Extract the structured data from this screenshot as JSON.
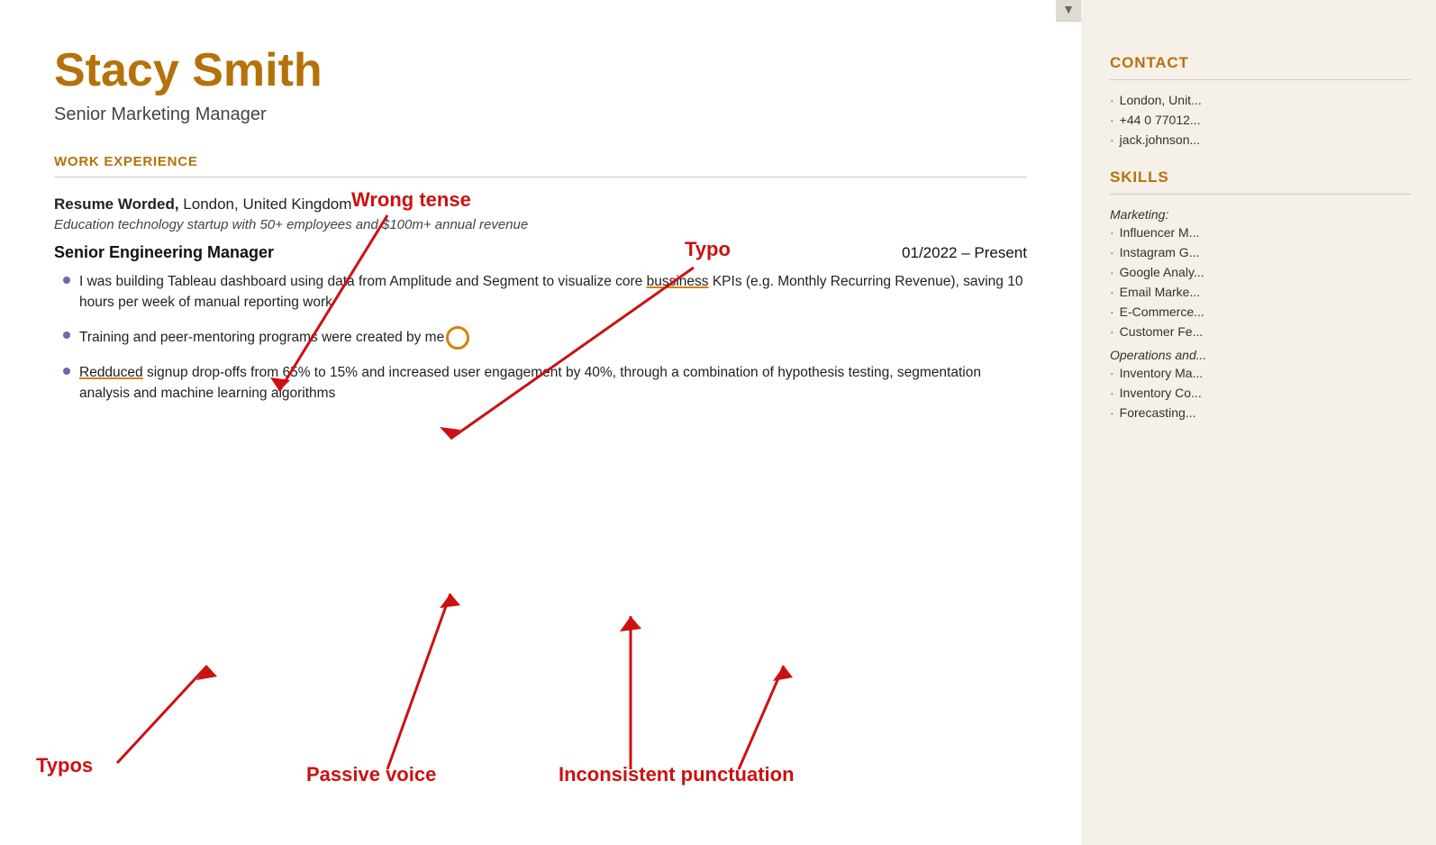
{
  "candidate": {
    "name": "Stacy Smith",
    "title": "Senior Marketing Manager"
  },
  "sections": {
    "work_experience_label": "WORK EXPERIENCE",
    "contact_label": "CONTACT",
    "skills_label": "SKILLS"
  },
  "work_experience": {
    "company": "Resume Worded,",
    "company_rest": " London, United Kingdom",
    "company_desc": "Education technology startup with 50+ employees and $100m+ annual revenue",
    "job_title": "Senior Engineering Manager",
    "dates": "01/2022 – Present",
    "bullets": [
      {
        "text_parts": [
          {
            "text": "I was building Tableau da"
          },
          {
            "text": "shboard using data from Amplitude and Segment to visualize core "
          },
          {
            "text": "bussiness",
            "underline": true
          },
          {
            "text": " KPIs (e.g. Monthly Recurring Revenue), saving 10 hours per week of manual reporting work"
          }
        ]
      },
      {
        "text_parts": [
          {
            "text": "Training and peer-mentoring programs were created by me"
          },
          {
            "text": ".",
            "circle": true
          }
        ]
      },
      {
        "text_parts": [
          {
            "text": "Redduced",
            "underline": true
          },
          {
            "text": " signup drop-offs from 65% to 15% and increased user engagement by 40%, through a combination of hypothesis testing, segmentation analysis and machine learning algorithms"
          }
        ]
      }
    ]
  },
  "annotations": {
    "wrong_tense": "Wrong tense",
    "typo_top": "Typo",
    "typos_bottom": "Typos",
    "passive_voice": "Passive voice",
    "inconsistent_punctuation": "Inconsistent punctuation"
  },
  "contact": {
    "items": [
      "London, Unit...",
      "+44 0 77012...",
      "jack.johnson..."
    ]
  },
  "skills": {
    "groups": [
      {
        "label": "Marketing:",
        "items": [
          "Influencer M...",
          "Instagram G...",
          "Google Analy...",
          "Email Marke...",
          "E-Commerce...",
          "Customer Fe..."
        ]
      },
      {
        "label": "Operations and...",
        "items": [
          "Inventory Ma...",
          "Inventory Co...",
          "Forecasting..."
        ]
      }
    ]
  },
  "scroll_icon": "▼"
}
